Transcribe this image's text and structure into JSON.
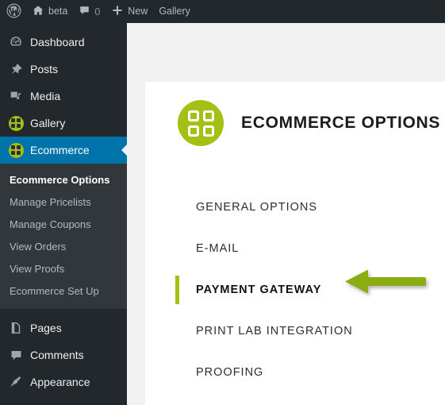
{
  "adminbar": {
    "items": [
      {
        "icon": "wordpress-logo-icon",
        "label": ""
      },
      {
        "icon": "home-icon",
        "label": "beta"
      },
      {
        "icon": "comment-icon",
        "label": "0"
      },
      {
        "icon": "plus-icon",
        "label": "New"
      },
      {
        "icon": "",
        "label": "Gallery"
      }
    ]
  },
  "sidebar": {
    "items": [
      {
        "label": "Dashboard",
        "icon": "dashboard-icon",
        "current": false
      },
      {
        "label": "Posts",
        "icon": "pin-icon",
        "current": false
      },
      {
        "label": "Media",
        "icon": "media-icon",
        "current": false
      },
      {
        "label": "Gallery",
        "icon": "grid-circle-icon",
        "current": false
      },
      {
        "label": "Ecommerce",
        "icon": "grid-circle-icon",
        "current": true
      },
      {
        "label": "Pages",
        "icon": "pages-icon",
        "current": false
      },
      {
        "label": "Comments",
        "icon": "comments-icon",
        "current": false
      },
      {
        "label": "Appearance",
        "icon": "appearance-icon",
        "current": false
      }
    ],
    "submenu": [
      {
        "label": "Ecommerce Options",
        "current": true
      },
      {
        "label": "Manage Pricelists",
        "current": false
      },
      {
        "label": "Manage Coupons",
        "current": false
      },
      {
        "label": "View Orders",
        "current": false
      },
      {
        "label": "View Proofs",
        "current": false
      },
      {
        "label": "Ecommerce Set Up",
        "current": false
      }
    ]
  },
  "page": {
    "title": "ECOMMERCE OPTIONS",
    "title_icon": "grid-circle-icon",
    "nav": [
      {
        "label": "GENERAL OPTIONS",
        "active": false
      },
      {
        "label": "E-MAIL",
        "active": false
      },
      {
        "label": "PAYMENT GATEWAY",
        "active": true
      },
      {
        "label": "PRINT LAB INTEGRATION",
        "active": false
      },
      {
        "label": "PROOFING",
        "active": false
      }
    ],
    "annotation": {
      "icon": "left-arrow-annotation-icon",
      "points_to": "PAYMENT GATEWAY"
    }
  },
  "colors": {
    "accent_green": "#a3c014",
    "admin_dark": "#23282d",
    "submenu_dark": "#32373c",
    "current_blue": "#0073aa",
    "page_bg": "#f1f1f1"
  }
}
